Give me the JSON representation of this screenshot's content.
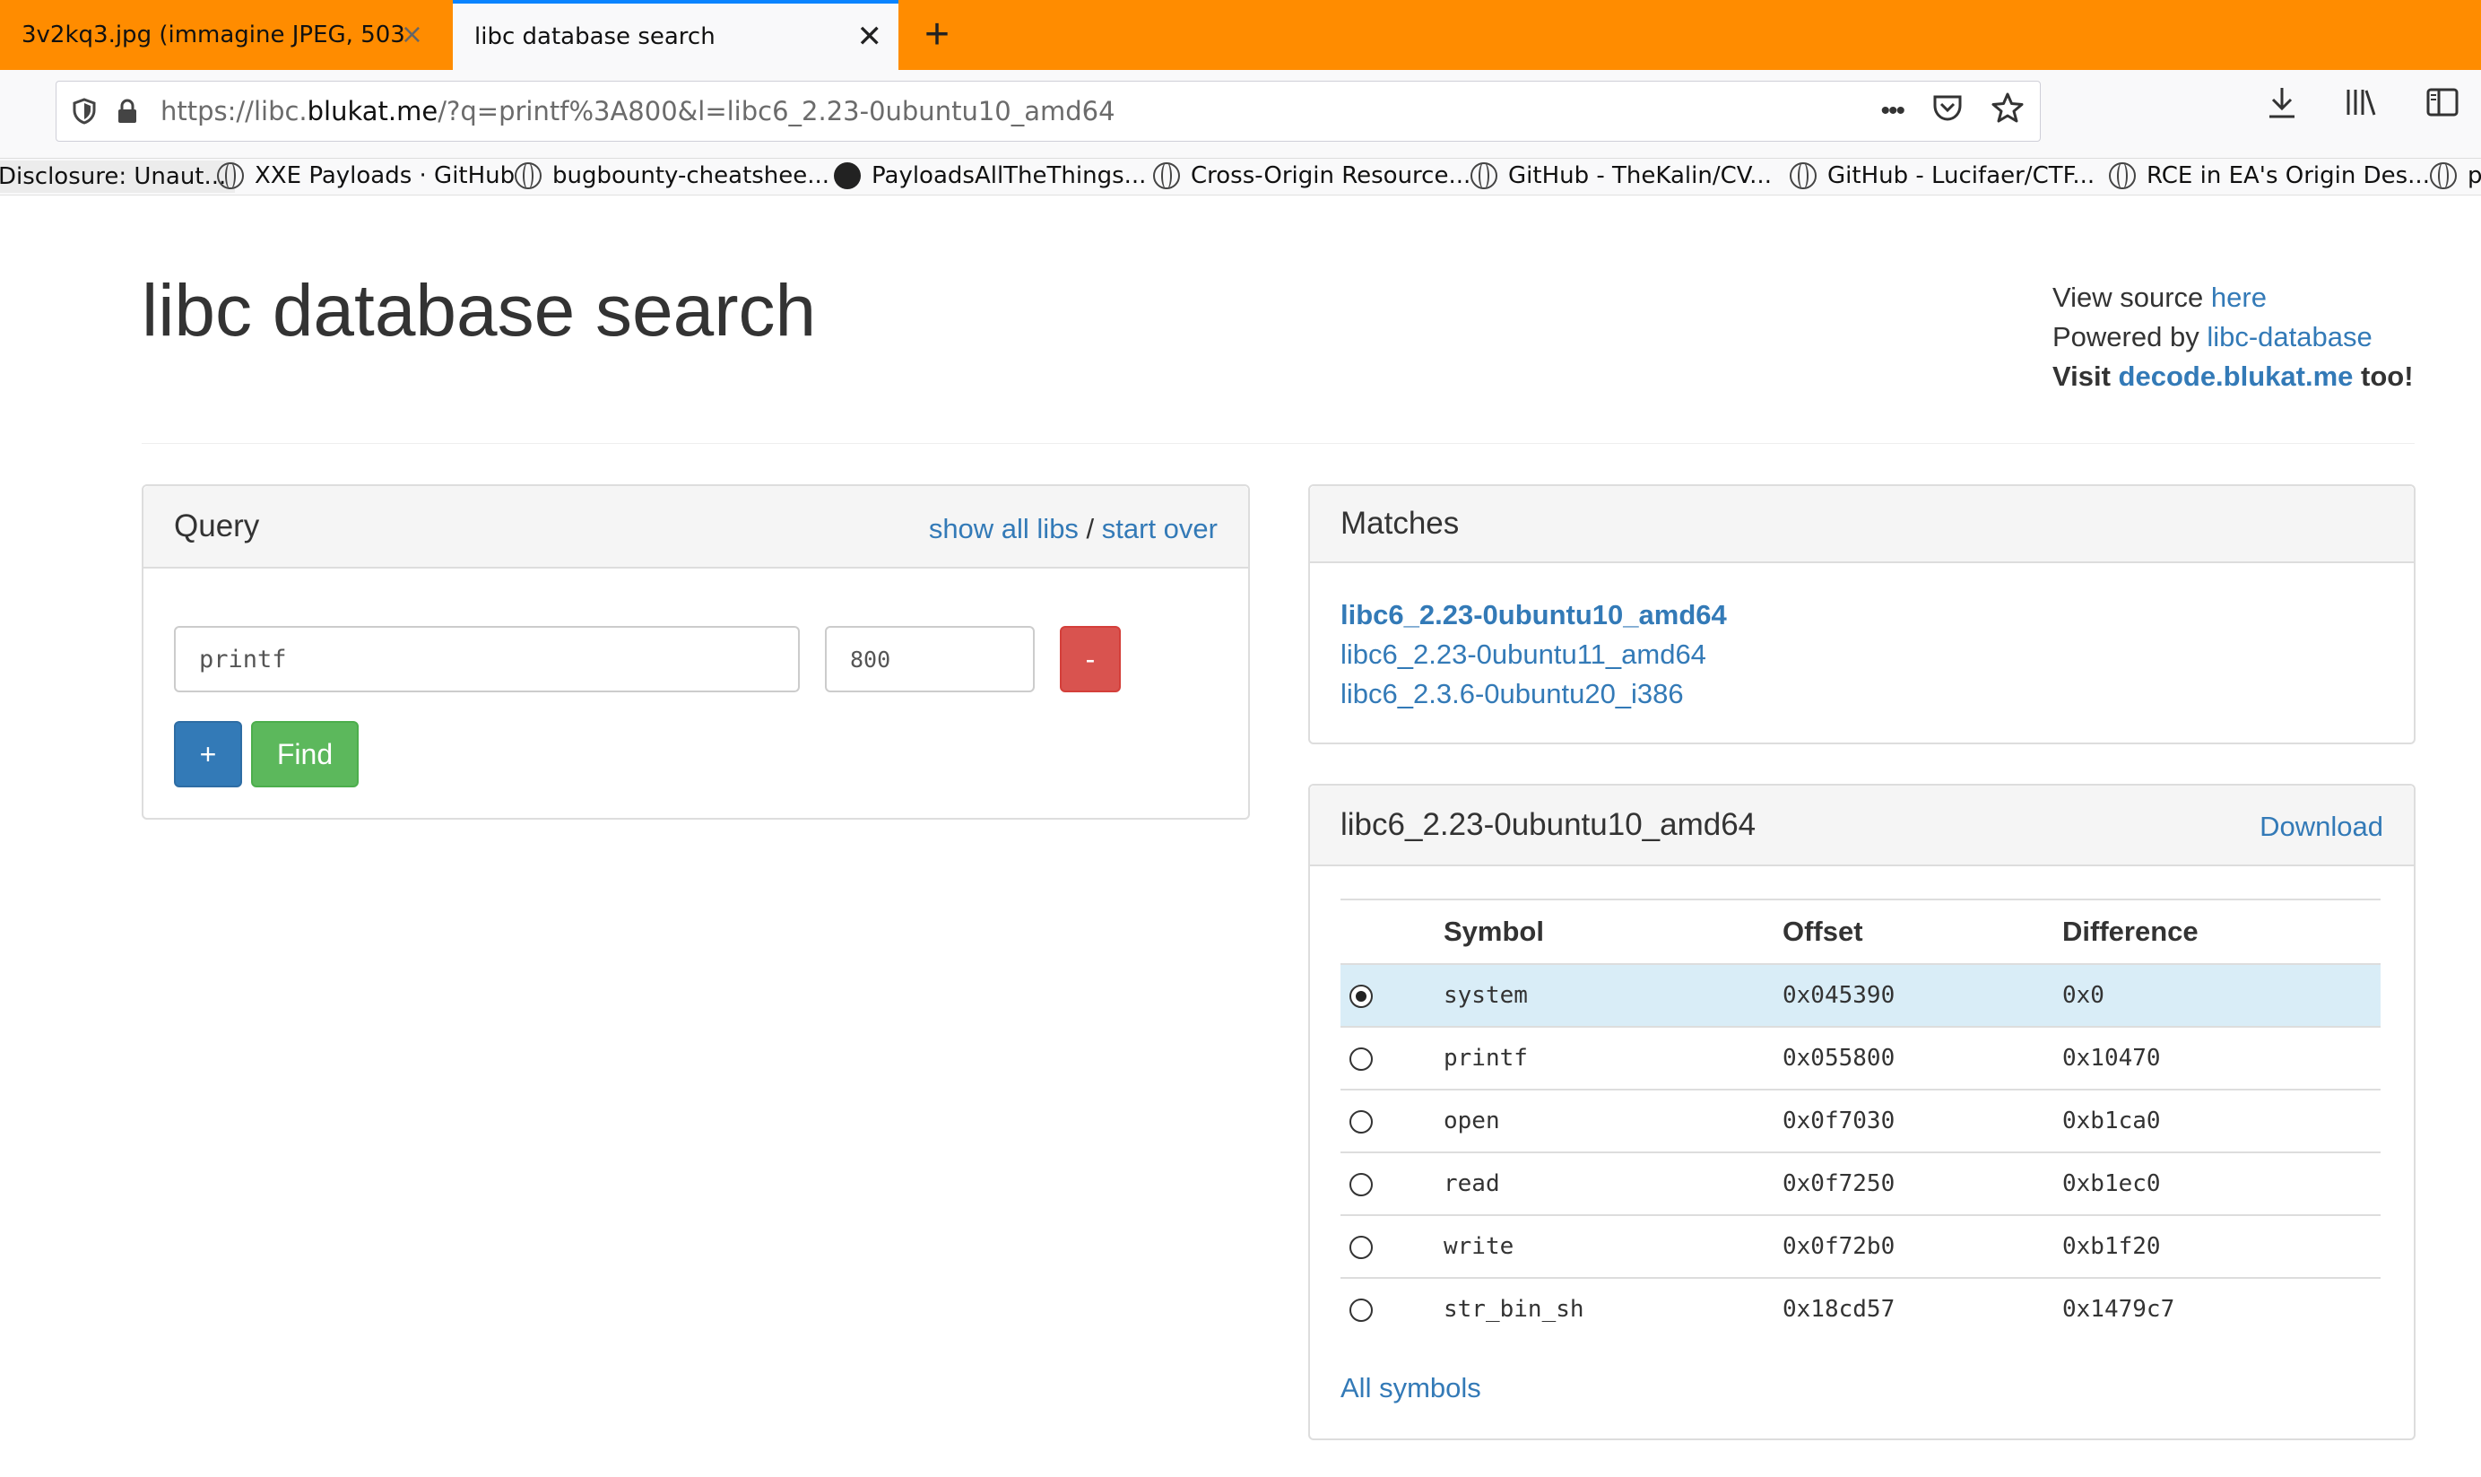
{
  "browser": {
    "tabs": [
      {
        "label": "3v2kq3.jpg (immagine JPEG, 503",
        "close": "×",
        "active": false
      },
      {
        "label": "libc database search",
        "close": "✕",
        "active": true
      }
    ],
    "new_tab": "+",
    "url_prefix": "https://libc.",
    "url_host": "blukat.me",
    "url_rest": "/?q=printf%3A800&l=libc6_2.23-0ubuntu10_amd64",
    "bookmarks": [
      "Disclosure: Unaut...",
      "XXE Payloads · GitHub",
      "bugbounty-cheatshee...",
      "PayloadsAllTheThings...",
      "Cross-Origin Resource...",
      "GitHub - TheKalin/CV...",
      "GitHub - Lucifaer/CTF...",
      "RCE in EA's Origin Des...",
      "p"
    ]
  },
  "page": {
    "title": "libc database search",
    "view_source_text": "View source ",
    "view_source_link": "here",
    "powered_by_text": "Powered by ",
    "powered_by_link": "libc-database",
    "visit_text": "Visit ",
    "visit_link": "decode.blukat.me",
    "visit_suffix": " too!"
  },
  "query": {
    "title": "Query",
    "show_all_libs": "show all libs",
    "separator": " / ",
    "start_over": "start over",
    "symbol_value": "printf",
    "offset_value": "800",
    "remove_label": "-",
    "add_label": "+",
    "find_label": "Find"
  },
  "matches": {
    "title": "Matches",
    "items": [
      "libc6_2.23-0ubuntu10_amd64",
      "libc6_2.23-0ubuntu11_amd64",
      "libc6_2.3.6-0ubuntu20_i386"
    ]
  },
  "lib": {
    "title": "libc6_2.23-0ubuntu10_amd64",
    "download": "Download",
    "headers": [
      "Symbol",
      "Offset",
      "Difference"
    ],
    "rows": [
      {
        "symbol": "system",
        "offset": "0x045390",
        "diff": "0x0"
      },
      {
        "symbol": "printf",
        "offset": "0x055800",
        "diff": "0x10470"
      },
      {
        "symbol": "open",
        "offset": "0x0f7030",
        "diff": "0xb1ca0"
      },
      {
        "symbol": "read",
        "offset": "0x0f7250",
        "diff": "0xb1ec0"
      },
      {
        "symbol": "write",
        "offset": "0x0f72b0",
        "diff": "0xb1f20"
      },
      {
        "symbol": "str_bin_sh",
        "offset": "0x18cd57",
        "diff": "0x1479c7"
      }
    ],
    "selected_row": 0,
    "all_symbols": "All symbols"
  }
}
